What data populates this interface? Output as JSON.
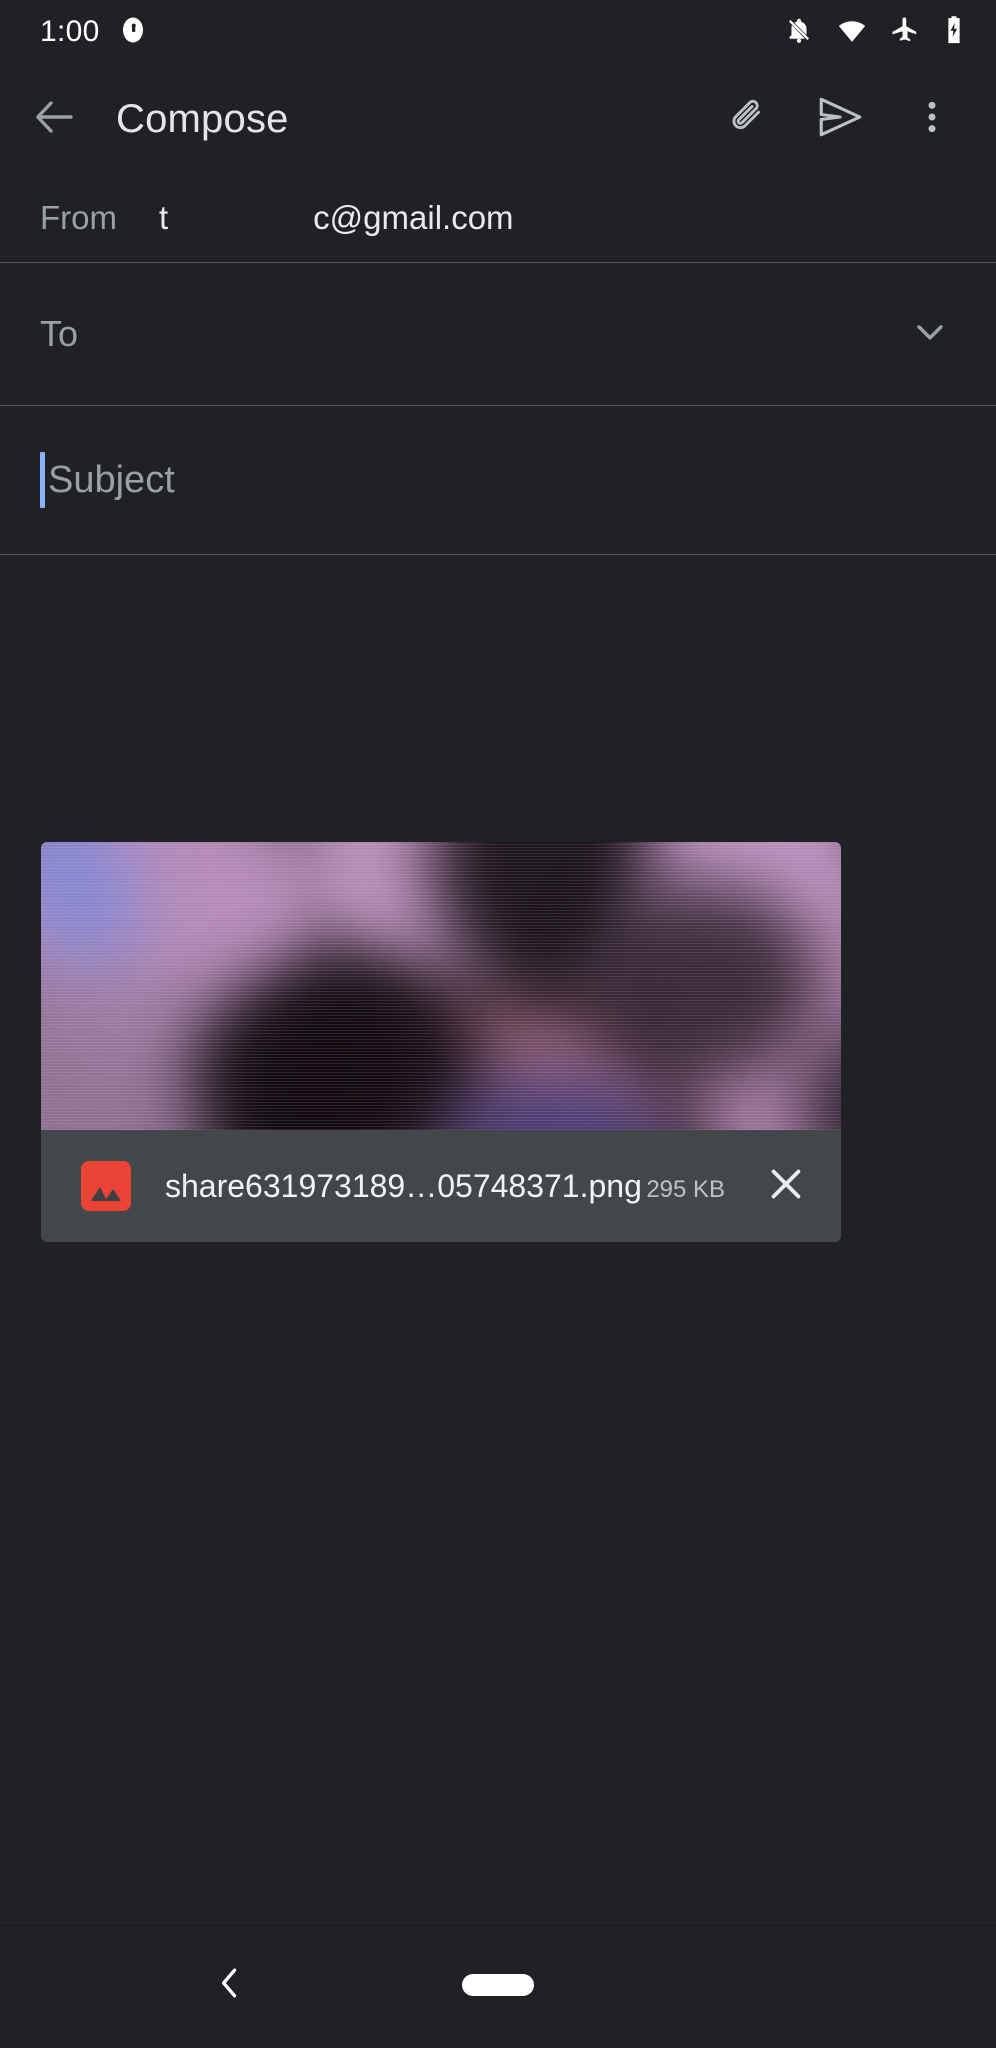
{
  "status_bar": {
    "time": "1:00",
    "left_icons": [
      {
        "name": "app-badge-icon",
        "label": "app badge"
      }
    ],
    "right_icons": [
      {
        "name": "notifications-off-icon",
        "label": "notifications off"
      },
      {
        "name": "wifi-icon",
        "label": "wifi"
      },
      {
        "name": "airplane-mode-icon",
        "label": "airplane mode"
      },
      {
        "name": "battery-charging-icon",
        "label": "battery charging"
      }
    ]
  },
  "app_bar": {
    "back_label": "Back",
    "title": "Compose",
    "actions": [
      {
        "name": "attach-button",
        "label": "Attach file"
      },
      {
        "name": "send-button",
        "label": "Send"
      },
      {
        "name": "more-options-button",
        "label": "More options"
      }
    ]
  },
  "fields": {
    "from": {
      "label": "From",
      "value_start": "t",
      "value_end": "c@gmail.com"
    },
    "to": {
      "label": "To",
      "value": "",
      "expand_label": "Show Cc/Bcc"
    },
    "subject": {
      "label": "Subject",
      "value": "",
      "cursor_visible": true
    }
  },
  "attachment": {
    "filename": "share631973189…05748371.png",
    "size": "295 KB",
    "file_type_icon": "image-file-icon",
    "remove_label": "Remove attachment",
    "preview_alt": "Blurred purple image preview"
  },
  "nav_bar": {
    "back_label": "Back",
    "home_label": "Home"
  },
  "colors": {
    "background": "#202124",
    "divider": "#55585c",
    "hint_text": "#9aa0a6",
    "primary_text": "#e8eaed",
    "cursor": "#8ab4f8",
    "attachment_bar": "#44474a",
    "file_icon": "#e94335"
  }
}
